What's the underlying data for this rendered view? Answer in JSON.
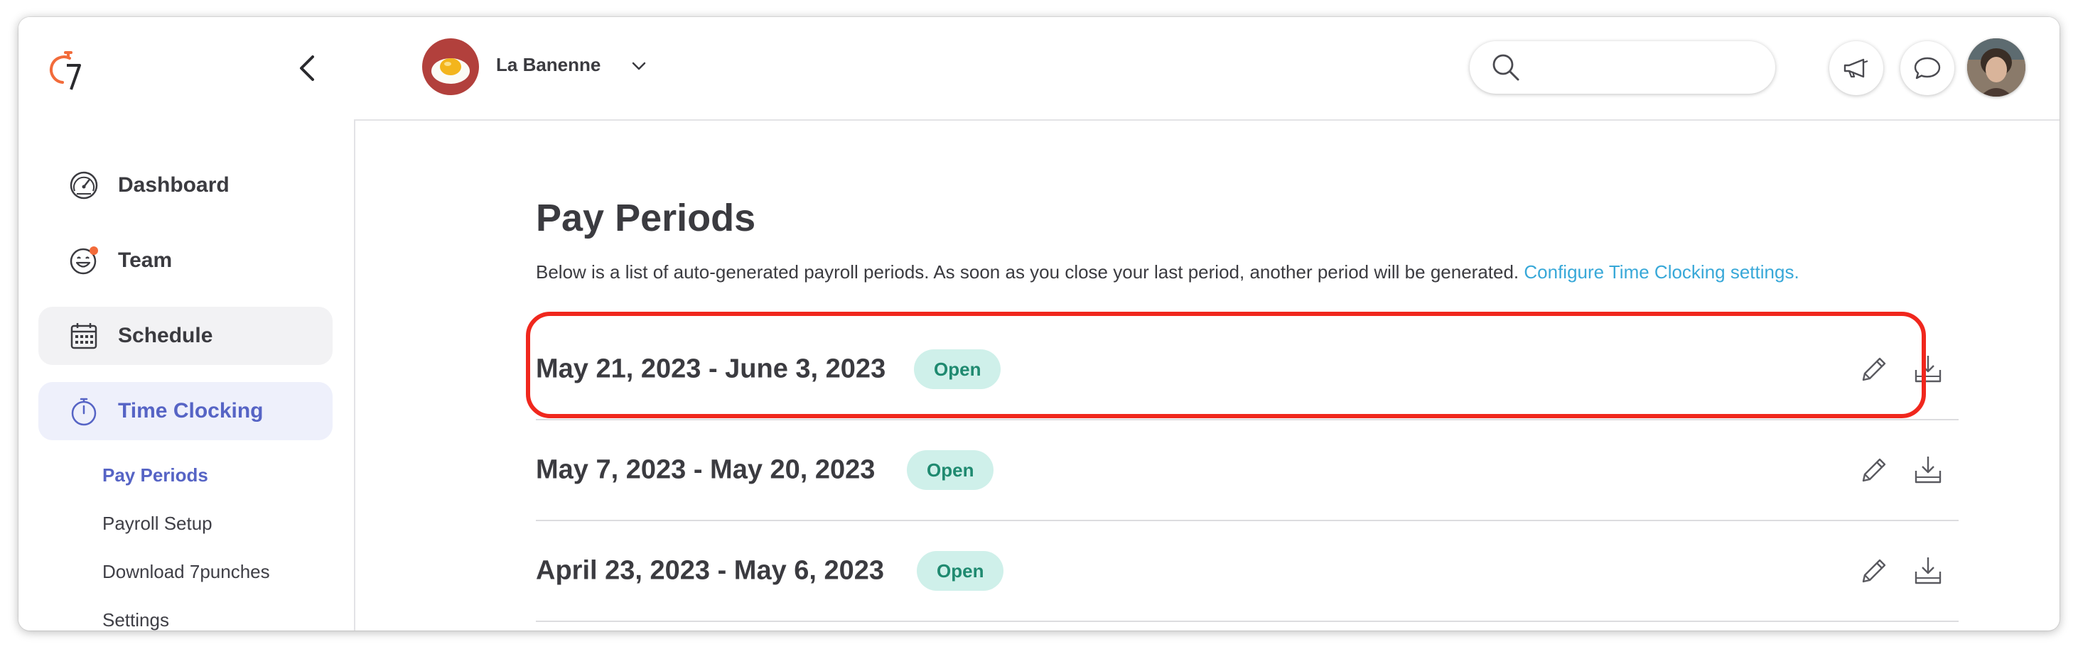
{
  "sidebar": {
    "nav": [
      {
        "label": "Dashboard",
        "icon": "speedometer-icon"
      },
      {
        "label": "Team",
        "icon": "smiley-face-icon",
        "badge_color": "#f26b3a"
      },
      {
        "label": "Schedule",
        "icon": "calendar-icon"
      },
      {
        "label": "Time Clocking",
        "icon": "stopwatch-icon",
        "active": true
      }
    ],
    "sub_nav": [
      {
        "label": "Pay Periods",
        "active": true
      },
      {
        "label": "Payroll Setup"
      },
      {
        "label": "Download 7punches"
      },
      {
        "label": "Settings"
      }
    ]
  },
  "header": {
    "venue_name": "La Banenne",
    "search": {
      "placeholder": "",
      "value": ""
    }
  },
  "main": {
    "title": "Pay Periods",
    "description": "Below is a list of auto-generated payroll periods. As soon as you close your last period, another period will be generated.",
    "config_link": "Configure Time Clocking settings.",
    "periods": [
      {
        "range": "May 21, 2023 - June 3, 2023",
        "status": "Open",
        "highlighted": true
      },
      {
        "range": "May 7, 2023 - May 20, 2023",
        "status": "Open"
      },
      {
        "range": "April 23, 2023 - May 6, 2023",
        "status": "Open"
      }
    ]
  },
  "colors": {
    "accent": "#5664c5",
    "link": "#38a8d8",
    "open_badge_bg": "#cff0ea",
    "open_badge_text": "#1f8a70",
    "highlight": "#f0271d",
    "logo_orange": "#f26b3a"
  }
}
